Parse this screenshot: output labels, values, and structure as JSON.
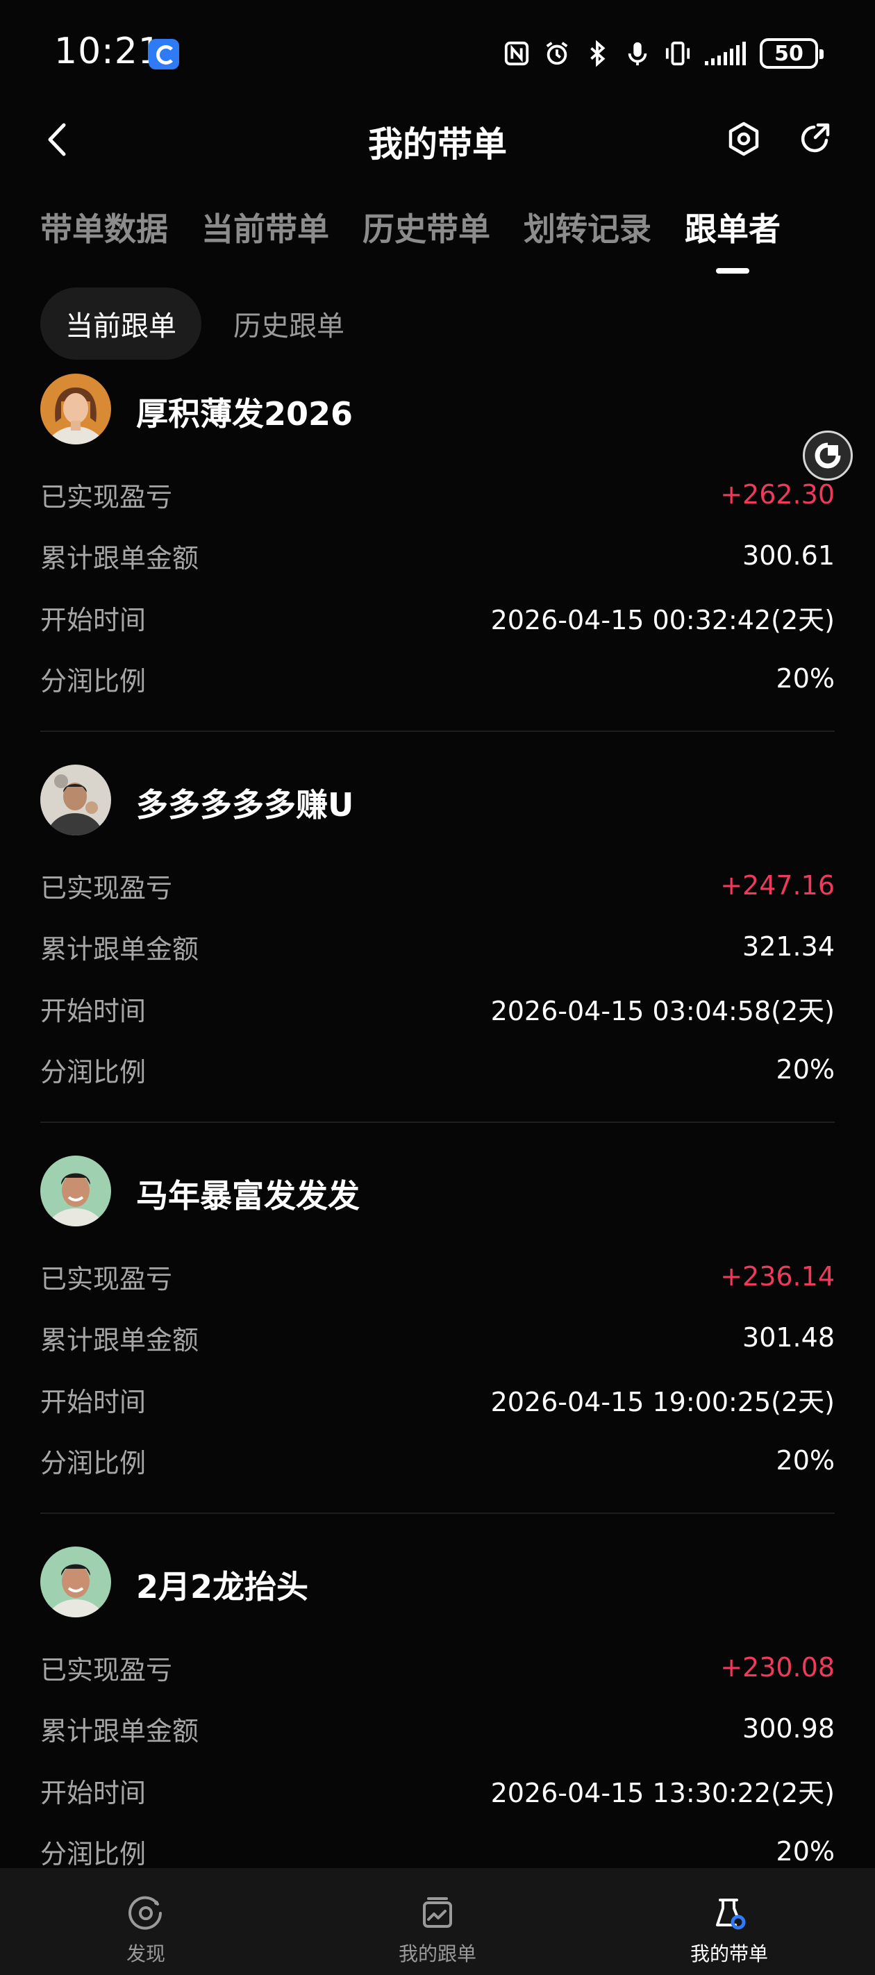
{
  "status_bar": {
    "time": "10:21",
    "battery": "50"
  },
  "header": {
    "title": "我的带单"
  },
  "main_tabs": [
    {
      "label": "带单数据"
    },
    {
      "label": "当前带单"
    },
    {
      "label": "历史带单"
    },
    {
      "label": "划转记录"
    },
    {
      "label": "跟单者",
      "active": true
    }
  ],
  "sub_tabs": [
    {
      "label": "当前跟单",
      "active": true
    },
    {
      "label": "历史跟单"
    }
  ],
  "row_labels": {
    "pnl": "已实现盈亏",
    "amount": "累计跟单金额",
    "start_time": "开始时间",
    "share_ratio": "分润比例"
  },
  "followers": [
    {
      "name": "厚积薄发2026",
      "pnl": "+262.30",
      "amount": "300.61",
      "start_time": "2026-04-15 00:32:42(2天)",
      "share_ratio": "20%"
    },
    {
      "name": "多多多多多赚U",
      "pnl": "+247.16",
      "amount": "321.34",
      "start_time": "2026-04-15 03:04:58(2天)",
      "share_ratio": "20%"
    },
    {
      "name": "马年暴富发发发",
      "pnl": "+236.14",
      "amount": "301.48",
      "start_time": "2026-04-15 19:00:25(2天)",
      "share_ratio": "20%"
    },
    {
      "name": "2月2龙抬头",
      "pnl": "+230.08",
      "amount": "300.98",
      "start_time": "2026-04-15 13:30:22(2天)",
      "share_ratio": "20%"
    }
  ],
  "bottom_nav": [
    {
      "label": "发现",
      "icon": "discover-icon"
    },
    {
      "label": "我的跟单",
      "icon": "my-copy-trades-icon"
    },
    {
      "label": "我的带单",
      "icon": "my-lead-trades-icon",
      "active": true
    }
  ],
  "colors": {
    "background": "#060606",
    "profit": "#ef3a5b",
    "accent_blue": "#2f7bf6"
  }
}
